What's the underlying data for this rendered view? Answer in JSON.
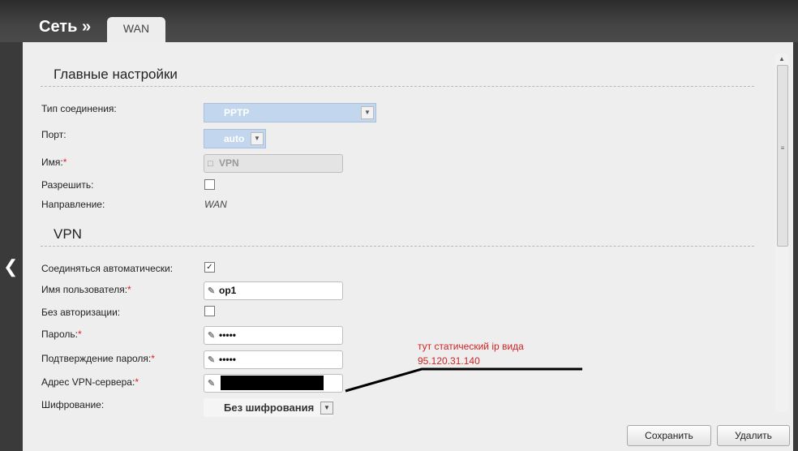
{
  "header": {
    "title": "Сеть »",
    "tab": "WAN"
  },
  "main": {
    "title": "Главные настройки",
    "connection_type": {
      "label": "Тип соединения:",
      "value": "PPTP"
    },
    "port": {
      "label": "Порт:",
      "value": "auto"
    },
    "name": {
      "label": "Имя:",
      "required": "*",
      "value": "VPN"
    },
    "allow": {
      "label": "Разрешить:",
      "checked": false
    },
    "direction": {
      "label": "Направление:",
      "value": "WAN"
    }
  },
  "vpn": {
    "title": "VPN",
    "auto_connect": {
      "label": "Соединяться автоматически:",
      "checked": true,
      "mark": "✓"
    },
    "username": {
      "label": "Имя пользователя:",
      "required": "*",
      "value": "op1"
    },
    "no_auth": {
      "label": "Без авторизации:",
      "checked": false
    },
    "password": {
      "label": "Пароль:",
      "required": "*",
      "value": "•••••"
    },
    "password_confirm": {
      "label": "Подтверждение пароля:",
      "required": "*",
      "value": "•••••"
    },
    "server": {
      "label": "Адрес VPN-сервера:",
      "required": "*",
      "value": ""
    },
    "encryption": {
      "label": "Шифрование:",
      "value": "Без шифрования"
    }
  },
  "annotation": {
    "line1": "тут статический ip вида",
    "line2": "95.120.31.140"
  },
  "buttons": {
    "save": "Сохранить",
    "delete": "Удалить"
  },
  "icons": {
    "back": "back-arrow-icon",
    "pencil": "pencil-icon",
    "lock": "lock-icon",
    "dropdown": "chevron-down-icon"
  },
  "colors": {
    "accent_select": "#c2d6ee",
    "required": "#e02020",
    "note": "#d02424"
  }
}
